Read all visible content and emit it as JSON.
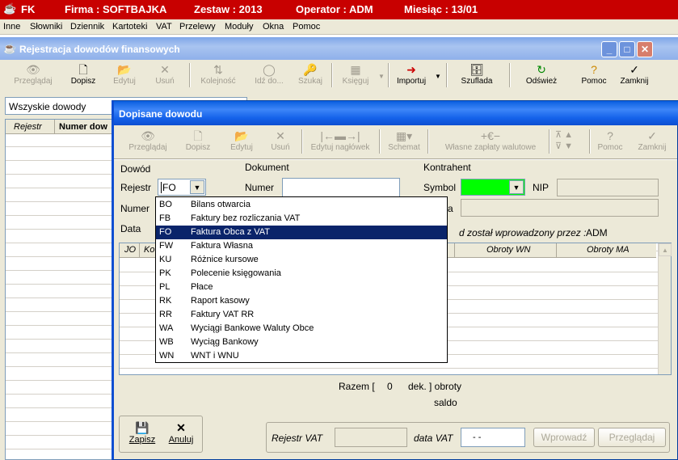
{
  "app": {
    "title": "FK",
    "firma": "Firma : SOFTBAJKA",
    "zestaw": "Zestaw : 2013",
    "operator": "Operator : ADM",
    "miesiac": "Miesiąc : 13/01"
  },
  "menu": [
    "Inne",
    "Słowniki",
    "Dziennik",
    "Kartoteki",
    "VAT",
    "Przelewy",
    "Moduły",
    "Okna",
    "Pomoc"
  ],
  "win1": {
    "title": "Rejestracja dowodów finansowych",
    "toolbar": [
      "Przeglądaj",
      "Dopisz",
      "Edytuj",
      "Usuń",
      "Kolejność",
      "Idź do...",
      "Szukaj",
      "Księguj",
      "Importuj",
      "Szuflada",
      "Odśwież",
      "Pomoc",
      "Zamknij"
    ],
    "filter": "Wszyskie dowody",
    "col_rejestr": "Rejestr",
    "col_numer": "Numer dow"
  },
  "dlg": {
    "title": "Dopisane dowodu",
    "toolbar": [
      "Przeglądaj",
      "Dopisz",
      "Edytuj",
      "Usuń",
      "Edytuj nagłówek",
      "Schemat",
      "Własne zapłaty walutowe",
      "Pomoc",
      "Zamknij"
    ],
    "sec_dowod": "Dowód",
    "sec_dokument": "Dokument",
    "sec_kontrahent": "Kontrahent",
    "lbl_rejestr": "Rejestr",
    "rejestr_value": "FO",
    "lbl_numer": "Numer",
    "lbl_numer2": "Numer",
    "lbl_data": "Data",
    "lbl_symbol": "Symbol",
    "lbl_nip": "NIP",
    "lbl_a": "a",
    "entered_by": "d został wprowadzony przez :",
    "entered_by_user": "ADM",
    "grid": {
      "jo": "JO",
      "ko": "Ko",
      "wn": "Obroty WN",
      "ma": "Obroty MA"
    },
    "razem": "Razem [",
    "razem_count": "0",
    "razem_suffix": "dek. ] obroty",
    "saldo": "saldo",
    "btn_zapisz": "Zapisz",
    "btn_anuluj": "Anuluj",
    "lbl_rejestr_vat": "Rejestr VAT",
    "lbl_data_vat": "data VAT",
    "data_vat_value": "- -",
    "btn_wprowadz": "Wprowadź",
    "btn_przegladaj": "Przeglądaj"
  },
  "dropdown": [
    {
      "code": "BO",
      "name": "Bilans otwarcia"
    },
    {
      "code": "FB",
      "name": "Faktury bez rozliczania VAT"
    },
    {
      "code": "FO",
      "name": "Faktura Obca z VAT"
    },
    {
      "code": "FW",
      "name": "Faktura Własna"
    },
    {
      "code": "KU",
      "name": "Różnice kursowe"
    },
    {
      "code": "PK",
      "name": "Polecenie księgowania"
    },
    {
      "code": "PL",
      "name": "Płace"
    },
    {
      "code": "RK",
      "name": "Raport kasowy"
    },
    {
      "code": "RR",
      "name": "Faktury VAT RR"
    },
    {
      "code": "WA",
      "name": "Wyciągi Bankowe Waluty Obce"
    },
    {
      "code": "WB",
      "name": "Wyciąg Bankowy"
    },
    {
      "code": "WN",
      "name": "WNT i WNU"
    }
  ],
  "colors": {
    "app_bar": "#c80000",
    "dlg_title": "#0a5fe0",
    "selection": "#0a246a",
    "symbol_field": "#00ff00"
  }
}
